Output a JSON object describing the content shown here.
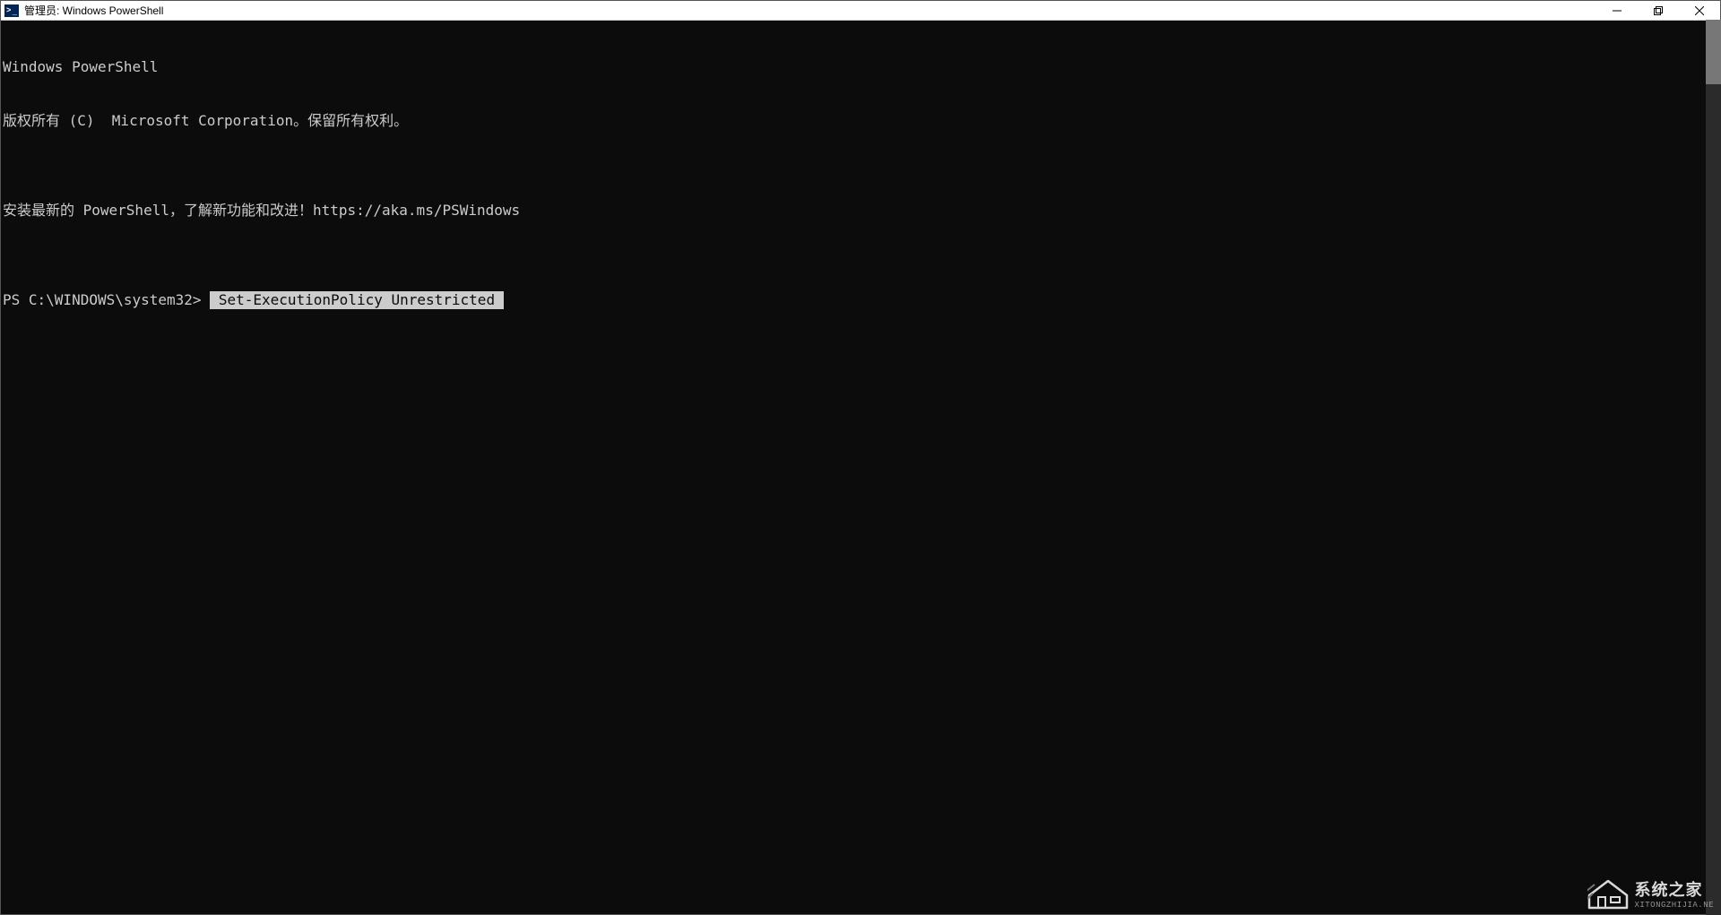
{
  "window": {
    "title": "管理员: Windows PowerShell"
  },
  "terminal": {
    "line1": "Windows PowerShell",
    "line2": "版权所有 (C)  Microsoft Corporation。保留所有权利。",
    "line3": "",
    "line4": "安装最新的 PowerShell，了解新功能和改进！https://aka.ms/PSWindows",
    "line5": "",
    "prompt": "PS C:\\WINDOWS\\system32> ",
    "command": " Set-ExecutionPolicy Unrestricted "
  },
  "watermark": {
    "cn": "系统之家",
    "en": "XITONGZHIJIA.NE"
  }
}
